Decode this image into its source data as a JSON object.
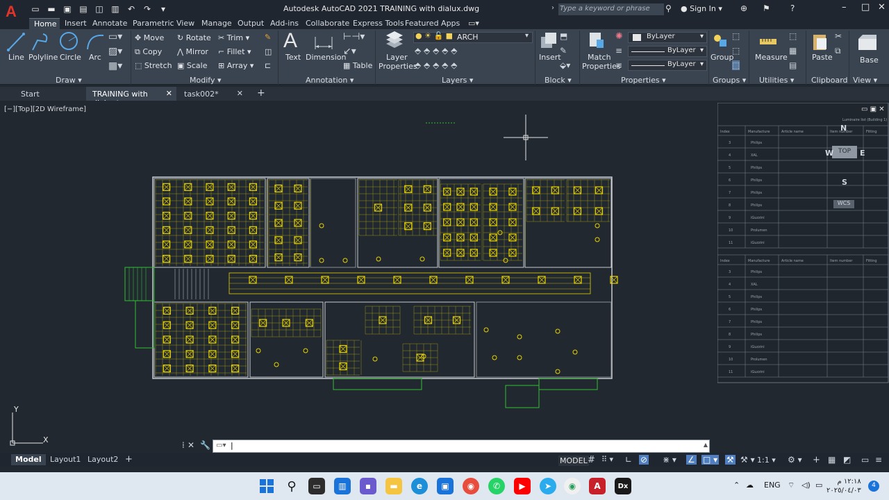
{
  "window": {
    "title": "Autodesk AutoCAD 2021    TRAINING with dialux.dwg",
    "app_letter": "A",
    "search_placeholder": "Type a keyword or phrase",
    "signin_label": "Sign In"
  },
  "ribbon_tabs": [
    "Home",
    "Insert",
    "Annotate",
    "Parametric",
    "View",
    "Manage",
    "Output",
    "Add-ins",
    "Collaborate",
    "Express Tools",
    "Featured Apps"
  ],
  "active_ribbon_tab": "Home",
  "draw_panel": {
    "line": "Line",
    "polyline": "Polyline",
    "circle": "Circle",
    "arc": "Arc",
    "label": "Draw"
  },
  "modify_panel": {
    "move": "Move",
    "rotate": "Rotate",
    "trim": "Trim",
    "copy": "Copy",
    "mirror": "Mirror",
    "fillet": "Fillet",
    "stretch": "Stretch",
    "scale": "Scale",
    "array": "Array",
    "label": "Modify"
  },
  "annotation_panel": {
    "text": "Text",
    "dimension": "Dimension",
    "table": "Table",
    "label": "Annotation"
  },
  "layers_panel": {
    "layer_properties_line1": "Layer",
    "layer_properties_line2": "Properties",
    "current_layer": "ARCH",
    "label": "Layers"
  },
  "block_panel": {
    "insert": "Insert",
    "label": "Block"
  },
  "properties_panel": {
    "match_line1": "Match",
    "match_line2": "Properties",
    "color": "ByLayer",
    "linetype": "ByLayer",
    "lineweight": "ByLayer",
    "label": "Properties"
  },
  "groups_panel": {
    "group": "Group",
    "label": "Groups"
  },
  "utilities_panel": {
    "measure": "Measure",
    "label": "Utilities"
  },
  "clipboard_panel": {
    "paste": "Paste",
    "label": "Clipboard"
  },
  "view_panel": {
    "base": "Base",
    "label": "View"
  },
  "document_tabs": [
    {
      "label": "Start"
    },
    {
      "label": "TRAINING with dialux*"
    },
    {
      "label": "task002*"
    }
  ],
  "viewport_label": "[−][Top][2D Wireframe]",
  "viewcube": {
    "north": "N",
    "south": "S",
    "east": "E",
    "west": "W",
    "face": "TOP",
    "wcs": "WCS"
  },
  "ucs": {
    "y": "Y",
    "x": "X"
  },
  "layout_tabs": [
    "Model",
    "Layout1",
    "Layout2"
  ],
  "status": {
    "model": "MODEL",
    "scale": "1:1"
  },
  "schedule_table": {
    "headers": [
      "Index",
      "Manufacture",
      "Article name",
      "Item number",
      "Fitting"
    ],
    "rows_top": [
      [
        "3",
        "Philips"
      ],
      [
        "4",
        "XAL"
      ],
      [
        "5",
        "Philips"
      ],
      [
        "6",
        "Philips"
      ],
      [
        "7",
        "Philips"
      ],
      [
        "8",
        "Philips"
      ],
      [
        "9",
        "iGuzzini"
      ],
      [
        "10",
        "Prolumen"
      ],
      [
        "11",
        "iGuzzini"
      ]
    ],
    "rows_bottom": [
      [
        "3",
        "Philips"
      ],
      [
        "4",
        "XAL"
      ],
      [
        "5",
        "Philips"
      ],
      [
        "6",
        "Philips"
      ],
      [
        "7",
        "Philips"
      ],
      [
        "8",
        "Philips"
      ],
      [
        "9",
        "iGuzzini"
      ],
      [
        "10",
        "Prolumen"
      ],
      [
        "11",
        "iGuzzini"
      ]
    ],
    "caption": "Luminaire list (Building 1)"
  },
  "taskbar": {
    "lang": "ENG",
    "time": "١٢:١٨ م",
    "date": "٢٠٢٥/٠٤/٠٣",
    "notif": "4"
  },
  "colors": {
    "accent": "#3a4350",
    "background": "#212830",
    "autocad_red": "#e3332a",
    "drawing_yellow": "#e8d300",
    "drawing_green": "#2fbf2f"
  }
}
